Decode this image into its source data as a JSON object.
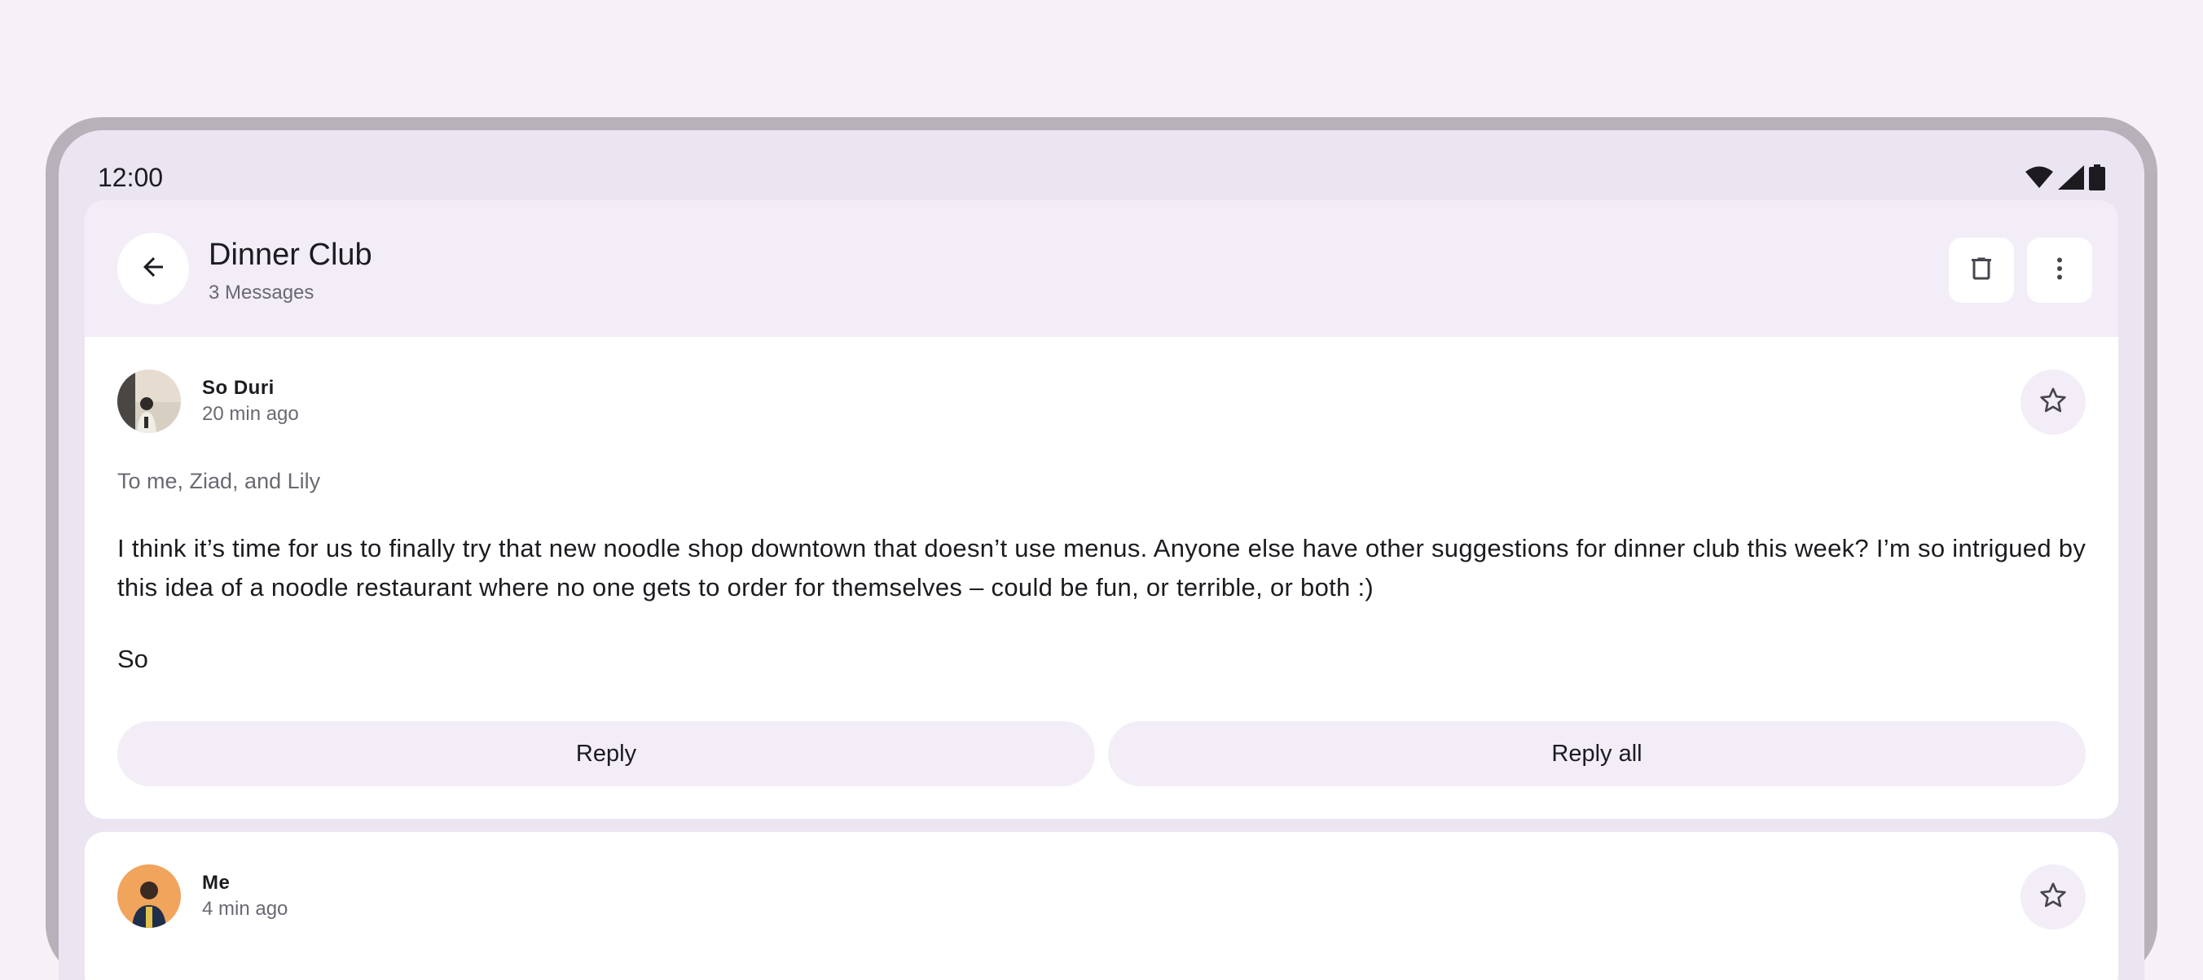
{
  "status_bar": {
    "time": "12:00",
    "icons": [
      "wifi-icon",
      "cellular-signal-icon",
      "battery-icon"
    ]
  },
  "header": {
    "title": "Dinner Club",
    "subtitle": "3 Messages",
    "back_icon": "arrow-back-icon",
    "actions": [
      "delete-icon",
      "more-vert-icon"
    ]
  },
  "messages": [
    {
      "sender": "So Duri",
      "time": "20 min ago",
      "recipients": "To me, Ziad, and Lily",
      "body": "I think it’s time for us to finally try that new noodle shop downtown that doesn’t use menus. Anyone else have other suggestions for dinner club this week? I’m so intrigued by this idea of a noodle restaurant where no one gets to order for themselves – could be fun, or terrible, or both :)",
      "signature": "So",
      "reply_label": "Reply",
      "reply_all_label": "Reply all"
    },
    {
      "sender": "Me",
      "time": "4 min ago"
    }
  ],
  "colors": {
    "background": "#f6f1f7",
    "surface": "#ebe5f2",
    "container": "#f3edf7",
    "card": "#ffffff"
  }
}
